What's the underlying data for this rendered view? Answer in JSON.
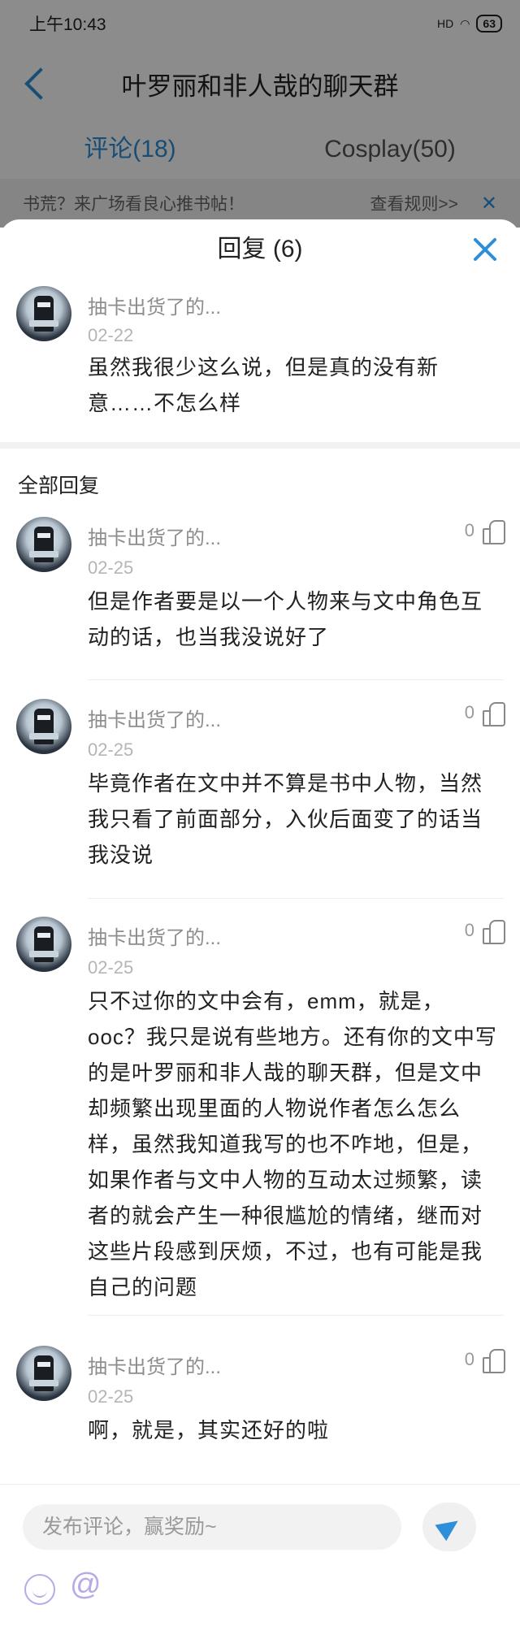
{
  "status": {
    "time": "上午10:43",
    "signal": "HD",
    "battery": "63"
  },
  "header": {
    "title": "叶罗丽和非人哉的聊天群"
  },
  "tabs": [
    {
      "label": "评论(18)"
    },
    {
      "label": "Cosplay(50)"
    }
  ],
  "notice": {
    "text": "书荒？来广场看良心推书帖！",
    "rule_link": "查看规则>>",
    "close": "✕"
  },
  "sheet": {
    "title": "回复 (6)"
  },
  "main_comment": {
    "user": "抽卡出货了的...",
    "date": "02-22",
    "text": "虽然我很少这么说，但是真的没有新意……不怎么样"
  },
  "section": {
    "label": "全部回复"
  },
  "replies": [
    {
      "user": "抽卡出货了的...",
      "date": "02-25",
      "likes": "0",
      "text": "但是作者要是以一个人物来与文中角色互动的话，也当我没说好了"
    },
    {
      "user": "抽卡出货了的...",
      "date": "02-25",
      "likes": "0",
      "text": "毕竟作者在文中并不算是书中人物，当然我只看了前面部分，入伙后面变了的话当我没说"
    },
    {
      "user": "抽卡出货了的...",
      "date": "02-25",
      "likes": "0",
      "text": "只不过你的文中会有，emm，就是，ooc？我只是说有些地方。还有你的文中写的是叶罗丽和非人哉的聊天群，但是文中却频繁出现里面的人物说作者怎么怎么样，虽然我知道我写的也不咋地，但是，如果作者与文中人物的互动太过频繁，读者的就会产生一种很尴尬的情绪，继而对这些片段感到厌烦，不过，也有可能是我自己的问题"
    },
    {
      "user": "抽卡出货了的...",
      "date": "02-25",
      "likes": "0",
      "text": "啊，就是，其实还好的啦"
    }
  ],
  "composer": {
    "placeholder": "发布评论，赢奖励~",
    "at_symbol": "@"
  },
  "colors": {
    "accent": "#2d8fd8",
    "emoji": "#b9a9e6"
  }
}
